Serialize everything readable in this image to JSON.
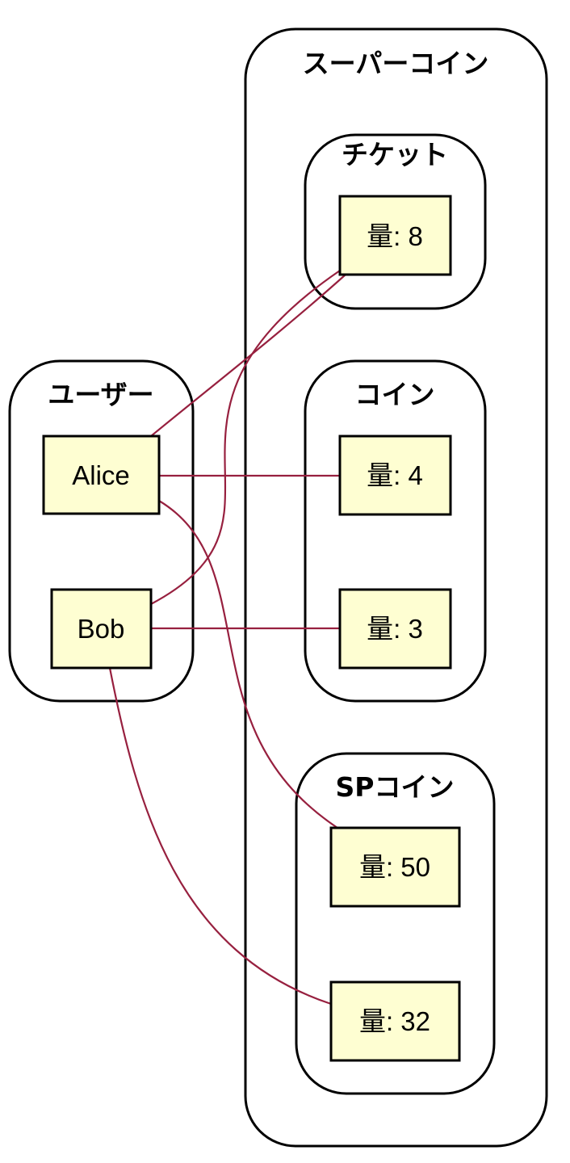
{
  "clusters": {
    "users": {
      "label": "ユーザー"
    },
    "supercoin": {
      "label": "スーパーコイン"
    },
    "ticket": {
      "label": "チケット"
    },
    "coin": {
      "label": "コイン"
    },
    "spcoin": {
      "label": "SPコイン"
    }
  },
  "nodes": {
    "alice": {
      "label": "Alice"
    },
    "bob": {
      "label": "Bob"
    },
    "ticket_amount": {
      "label": "量: 8"
    },
    "coin_amount_alice": {
      "label": "量: 4"
    },
    "coin_amount_bob": {
      "label": "量: 3"
    },
    "sp_amount_alice": {
      "label": "量: 50"
    },
    "sp_amount_bob": {
      "label": "量: 32"
    }
  },
  "edges": [
    {
      "from": "alice",
      "to": "ticket_amount"
    },
    {
      "from": "bob",
      "to": "ticket_amount"
    },
    {
      "from": "alice",
      "to": "coin_amount_alice"
    },
    {
      "from": "bob",
      "to": "coin_amount_bob"
    },
    {
      "from": "alice",
      "to": "sp_amount_alice"
    },
    {
      "from": "bob",
      "to": "sp_amount_bob"
    }
  ],
  "colors": {
    "node_fill": "#fefed2",
    "edge": "#97203f",
    "border": "#000000"
  }
}
